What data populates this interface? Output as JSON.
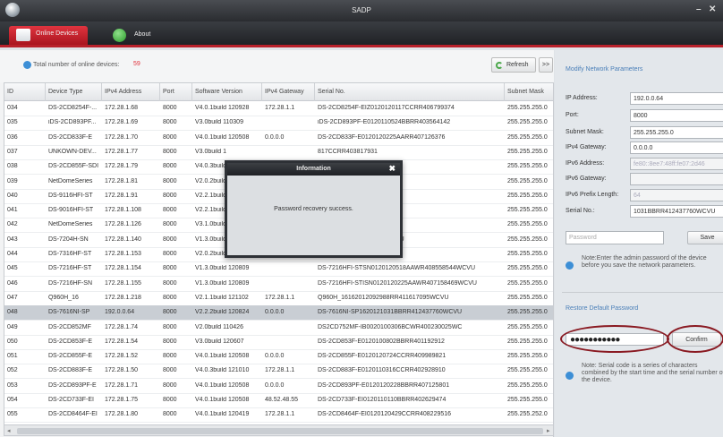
{
  "window": {
    "title": "SADP",
    "controls": [
      "–",
      "✕"
    ]
  },
  "tabs": [
    {
      "label": "Online Devices",
      "active": true,
      "icon": "monitor-icon"
    },
    {
      "label": "About",
      "active": false,
      "icon": "info-icon"
    }
  ],
  "toolbar": {
    "total_label": "Total number of online devices:",
    "total_count": "59",
    "refresh_label": "Refresh",
    "more_label": ">>"
  },
  "table": {
    "columns": [
      "ID",
      "Device Type",
      "IPv4 Address",
      "Port",
      "Software Version",
      "IPv4 Gateway",
      "Serial No.",
      "Subnet Mask"
    ],
    "rows": [
      [
        "034",
        "DS-2CD8254F-...",
        "172.28.1.68",
        "8000",
        "V4.0.1build 120928",
        "172.28.1.1",
        "DS-2CD8254F-EIZ0120120117CCRR406799374",
        "255.255.255.0"
      ],
      [
        "035",
        "iDS-2CD893PF...",
        "172.28.1.69",
        "8000",
        "V3.0build 110309",
        "",
        "iDS-2CD893PF-E0120110524BBRR403564142",
        "255.255.255.0"
      ],
      [
        "036",
        "DS-2CD833F-E",
        "172.28.1.70",
        "8000",
        "V4.0.1build 120508",
        "0.0.0.0",
        "DS-2CD833F-E0120120225AARR407126376",
        "255.255.255.0"
      ],
      [
        "037",
        "UNKOWN-DEV...",
        "172.28.1.77",
        "8000",
        "V3.0build 1",
        "",
        "817CCRR403817931",
        "255.255.255.0"
      ],
      [
        "038",
        "DS-2CD855F-SDI",
        "172.28.1.79",
        "8000",
        "V4.0.3build",
        "",
        "206AARR406113299",
        "255.255.255.0"
      ],
      [
        "039",
        "NetDomeSeries",
        "172.28.1.81",
        "8000",
        "V2.0.2build",
        "",
        "14BCWR402578228WC",
        "255.255.255.0"
      ],
      [
        "040",
        "DS-9116HFI-ST",
        "172.28.1.91",
        "8000",
        "V2.2.1build",
        "",
        "8BBRR404153249WCVU",
        "255.255.255.0"
      ],
      [
        "041",
        "DS-9016HFI-ST",
        "172.28.1.108",
        "8000",
        "V2.2.1build",
        "",
        "05BBRR406579336WCVU",
        "255.255.255.0"
      ],
      [
        "042",
        "NetDomeSeries",
        "172.28.1.126",
        "8000",
        "V3.1.0build",
        "",
        "24BCWR403022298WC",
        "255.255.255.0"
      ],
      [
        "043",
        "DS-7204H-SN",
        "172.28.1.140",
        "8000",
        "V1.3.0build",
        "",
        "20703AAWR409451078WCVU",
        "255.255.255.0"
      ],
      [
        "044",
        "DS-7316HF-ST",
        "172.28.1.153",
        "8000",
        "V2.0.2build",
        "",
        "19BBWR407498624WCVU",
        "255.255.255.0"
      ],
      [
        "045",
        "DS-7216HF-ST",
        "172.28.1.154",
        "8000",
        "V1.3.0build 120809",
        "",
        "DS-7216HFI-STSN0120120518AAWR408558544WCVU",
        "255.255.255.0"
      ],
      [
        "046",
        "DS-7216HF-SN",
        "172.28.1.155",
        "8000",
        "V1.3.0build 120809",
        "",
        "DS-7216HFI-STISN0120120225AAWR407158469WCVU",
        "255.255.255.0"
      ],
      [
        "047",
        "Q960H_16",
        "172.28.1.218",
        "8000",
        "V2.1.1build 121102",
        "172.28.1.1",
        "Q960H_16162012092988RR411617095WCVU",
        "255.255.255.0"
      ],
      [
        "048",
        "DS-7616NI-SP",
        "192.0.0.64",
        "8000",
        "V2.2.2build 120824",
        "0.0.0.0",
        "DS-7616NI-SP1620121031BBRR412437760WCVU",
        "255.255.255.0"
      ],
      [
        "049",
        "DS-2CD852MF",
        "172.28.1.74",
        "8000",
        "V2.0build 110426",
        "",
        "DS2CD752MF-IB0020100306BCWR400230025WC",
        "255.255.255.0"
      ],
      [
        "050",
        "DS-2CD853F-E",
        "172.28.1.54",
        "8000",
        "V3.0build 120607",
        "",
        "DS-2CD853F-E0120100802BBRR401192912",
        "255.255.255.0"
      ],
      [
        "051",
        "DS-2CD855F-E",
        "172.28.1.52",
        "8000",
        "V4.0.1build 120508",
        "0.0.0.0",
        "DS-2CD855F-E0120120724CCRR409989821",
        "255.255.255.0"
      ],
      [
        "052",
        "DS-2CD883F-E",
        "172.28.1.50",
        "8000",
        "V4.0.3build 121010",
        "172.28.1.1",
        "DS-2CD883F-E0120110316CCRR402928910",
        "255.255.255.0"
      ],
      [
        "053",
        "DS-2CD893PF-E",
        "172.28.1.71",
        "8000",
        "V4.0.1build 120508",
        "0.0.0.0",
        "DS-2CD893PF-E0120120228BBRR407125801",
        "255.255.255.0"
      ],
      [
        "054",
        "DS-2CD733F-EI",
        "172.28.1.75",
        "8000",
        "V4.0.1build 120508",
        "48.52.48.55",
        "DS-2CD733F-EI0120110110BBRR402629474",
        "255.255.255.0"
      ],
      [
        "055",
        "DS-2CD8464F-EI",
        "172.28.1.80",
        "8000",
        "V4.0.1build 120419",
        "172.28.1.1",
        "DS-2CD8464F-EI0120120429CCRR408229516",
        "255.255.252.0"
      ]
    ],
    "selected_row": 14
  },
  "modify": {
    "title": "Modify Network Parameters",
    "ip_label": "IP Address:",
    "ip_value": "192.0.0.64",
    "port_label": "Port:",
    "port_value": "8000",
    "mask_label": "Subnet Mask:",
    "mask_value": "255.255.255.0",
    "gw_label": "IPv4 Gateway:",
    "gw_value": "0.0.0.0",
    "v6addr_label": "IPv6 Address:",
    "v6addr_value": "fe80::8ee7:48ff:fe07:2d46",
    "v6gw_label": "IPv6 Gateway:",
    "v6gw_value": "",
    "v6prefix_label": "IPv6 Prefix Length:",
    "v6prefix_value": "64",
    "serial_label": "Serial No.:",
    "serial_value": "1031BBRR412437760WCVU",
    "password_placeholder": "Password",
    "save_label": "Save",
    "note": "Note:Enter the admin password of the device before you save the network parameters."
  },
  "restore": {
    "title": "Restore Default Password",
    "code_value": "●●●●●●●●●●●",
    "confirm_label": "Confirm",
    "note": "Note: Serial code is a series of characters combined by the start time and the serial number of the device."
  },
  "dialog": {
    "title": "Information",
    "close": "✖",
    "message": "Password recovery success."
  }
}
